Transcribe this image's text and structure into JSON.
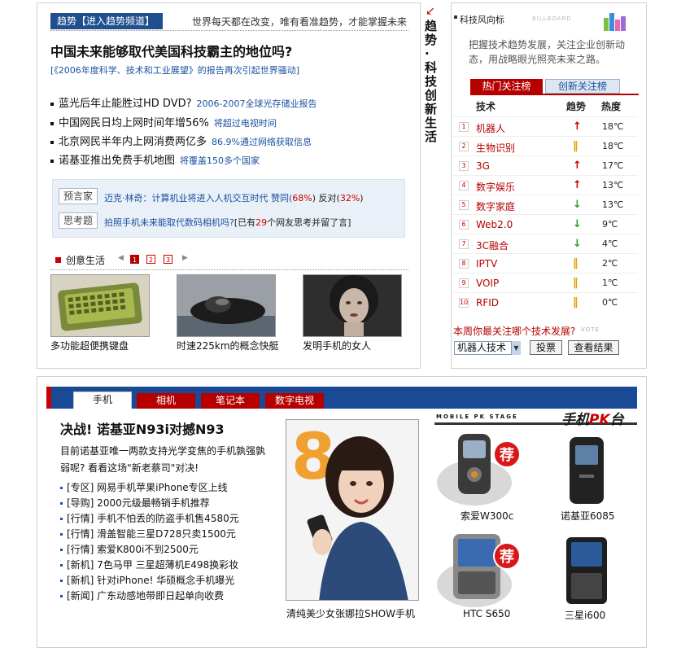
{
  "trend": {
    "tag": "趋势【进入趋势频道】",
    "slogan": "世界每天都在改变，唯有看准趋势，才能掌握未来",
    "headline": "中国未来能够取代美国科技霸主的地位吗?",
    "subhead": "[《2006年度科学、技术和工业展望》的报告再次引起世界骚动]",
    "news": [
      {
        "title": "蓝光后年止能胜过HD DVD?",
        "sub": "2006-2007全球光存储业报告"
      },
      {
        "title": "中国网民日均上网时间年增56%",
        "sub": "将超过电视时间"
      },
      {
        "title": "北京网民半年内上网消费两亿多",
        "sub": "86.9%通过网络获取信息"
      },
      {
        "title": "诺基亚推出免费手机地图",
        "sub": "将覆盖150多个国家"
      }
    ],
    "prediction_label": "预言家",
    "prediction_text_a": "迈克·林奇：计算机业将进入人机交互时代 赞同(",
    "prediction_agree": "68%",
    "prediction_text_b": ") 反对(",
    "prediction_disagree": "32%",
    "prediction_text_c": ")",
    "think_label": "思考题",
    "think_text_a": "拍照手机未来能取代数码相机吗?",
    "think_text_b": "[已有",
    "think_count": "29",
    "think_text_c": "个网友思考并留了言]"
  },
  "life": {
    "title": "创意生活",
    "arrow_left": "◀",
    "arrow_right": "▶",
    "pages": [
      "1",
      "2",
      "3"
    ],
    "items": [
      {
        "caption": "多功能超便携键盘"
      },
      {
        "caption": "时速225km的概念快艇"
      },
      {
        "caption": "发明手机的女人"
      }
    ]
  },
  "vertical": {
    "arrow": "↙",
    "title": "趋势·科技创新生活"
  },
  "billboard": {
    "title": "科技风向标",
    "tag": "BILLBOARD",
    "desc": "把握技术趋势发展，关注企业创新动态，用战略眼光照亮未来之路。",
    "tab_hot": "热门关注榜",
    "tab_new": "创新关注榜",
    "col_tech": "技术",
    "col_trend": "趋势",
    "col_heat": "热度",
    "rows": [
      {
        "rank": "1",
        "name": "机器人",
        "trend": "up",
        "heat": "18℃"
      },
      {
        "rank": "2",
        "name": "生物识别",
        "trend": "flat",
        "heat": "18℃"
      },
      {
        "rank": "3",
        "name": "3G",
        "trend": "up",
        "heat": "17℃"
      },
      {
        "rank": "4",
        "name": "数字娱乐",
        "trend": "up",
        "heat": "13℃"
      },
      {
        "rank": "5",
        "name": "数字家庭",
        "trend": "down",
        "heat": "13℃"
      },
      {
        "rank": "6",
        "name": "Web2.0",
        "trend": "down",
        "heat": "9℃"
      },
      {
        "rank": "7",
        "name": "3C融合",
        "trend": "down",
        "heat": "4℃"
      },
      {
        "rank": "8",
        "name": "IPTV",
        "trend": "flat",
        "heat": "2℃"
      },
      {
        "rank": "9",
        "name": "VOIP",
        "trend": "flat",
        "heat": "1℃"
      },
      {
        "rank": "10",
        "name": "RFID",
        "trend": "flat",
        "heat": "0℃"
      }
    ],
    "question": "本周你最关注哪个技术发展?",
    "vote_tag": "VOTE",
    "select_value": "机器人技术",
    "vote_button": "投票",
    "result_button": "查看结果"
  },
  "mobile": {
    "tabs": [
      "手机",
      "相机",
      "笔记本",
      "数字电视"
    ],
    "headline": "决战! 诺基亚N93i对撼N93",
    "intro": "目前诺基亚唯一两款支持光学变焦的手机孰强孰弱呢? 看看这场\"新老蔡司\"对决!",
    "list": [
      "[专区] 网易手机苹果iPhone专区上线",
      "[导购] 2000元级最畅销手机推荐",
      "[行情] 手机不怕丢的防盗手机售4580元",
      "[行情] 滑盖智能三星D728只卖1500元",
      "[行情] 索爱K800i不到2500元",
      "[新机] 7色马甲 三星超薄机E498换彩妆",
      "[新机] 针对iPhone! 华硕概念手机曝光",
      "[新闻] 广东动感地带即日起单向收费"
    ],
    "photo_caption": "清纯美少女张娜拉SHOW手机",
    "photo_number": "8",
    "pk_stage": "MOBILE PK STAGE",
    "pk_logo_a": "手机",
    "pk_logo_b": "PK",
    "pk_logo_c": "台",
    "recommend": "荐",
    "phones": [
      {
        "caption": "索爱W300c"
      },
      {
        "caption": "诺基亚6085"
      },
      {
        "caption": "HTC S650"
      },
      {
        "caption": "三星i600"
      }
    ]
  }
}
